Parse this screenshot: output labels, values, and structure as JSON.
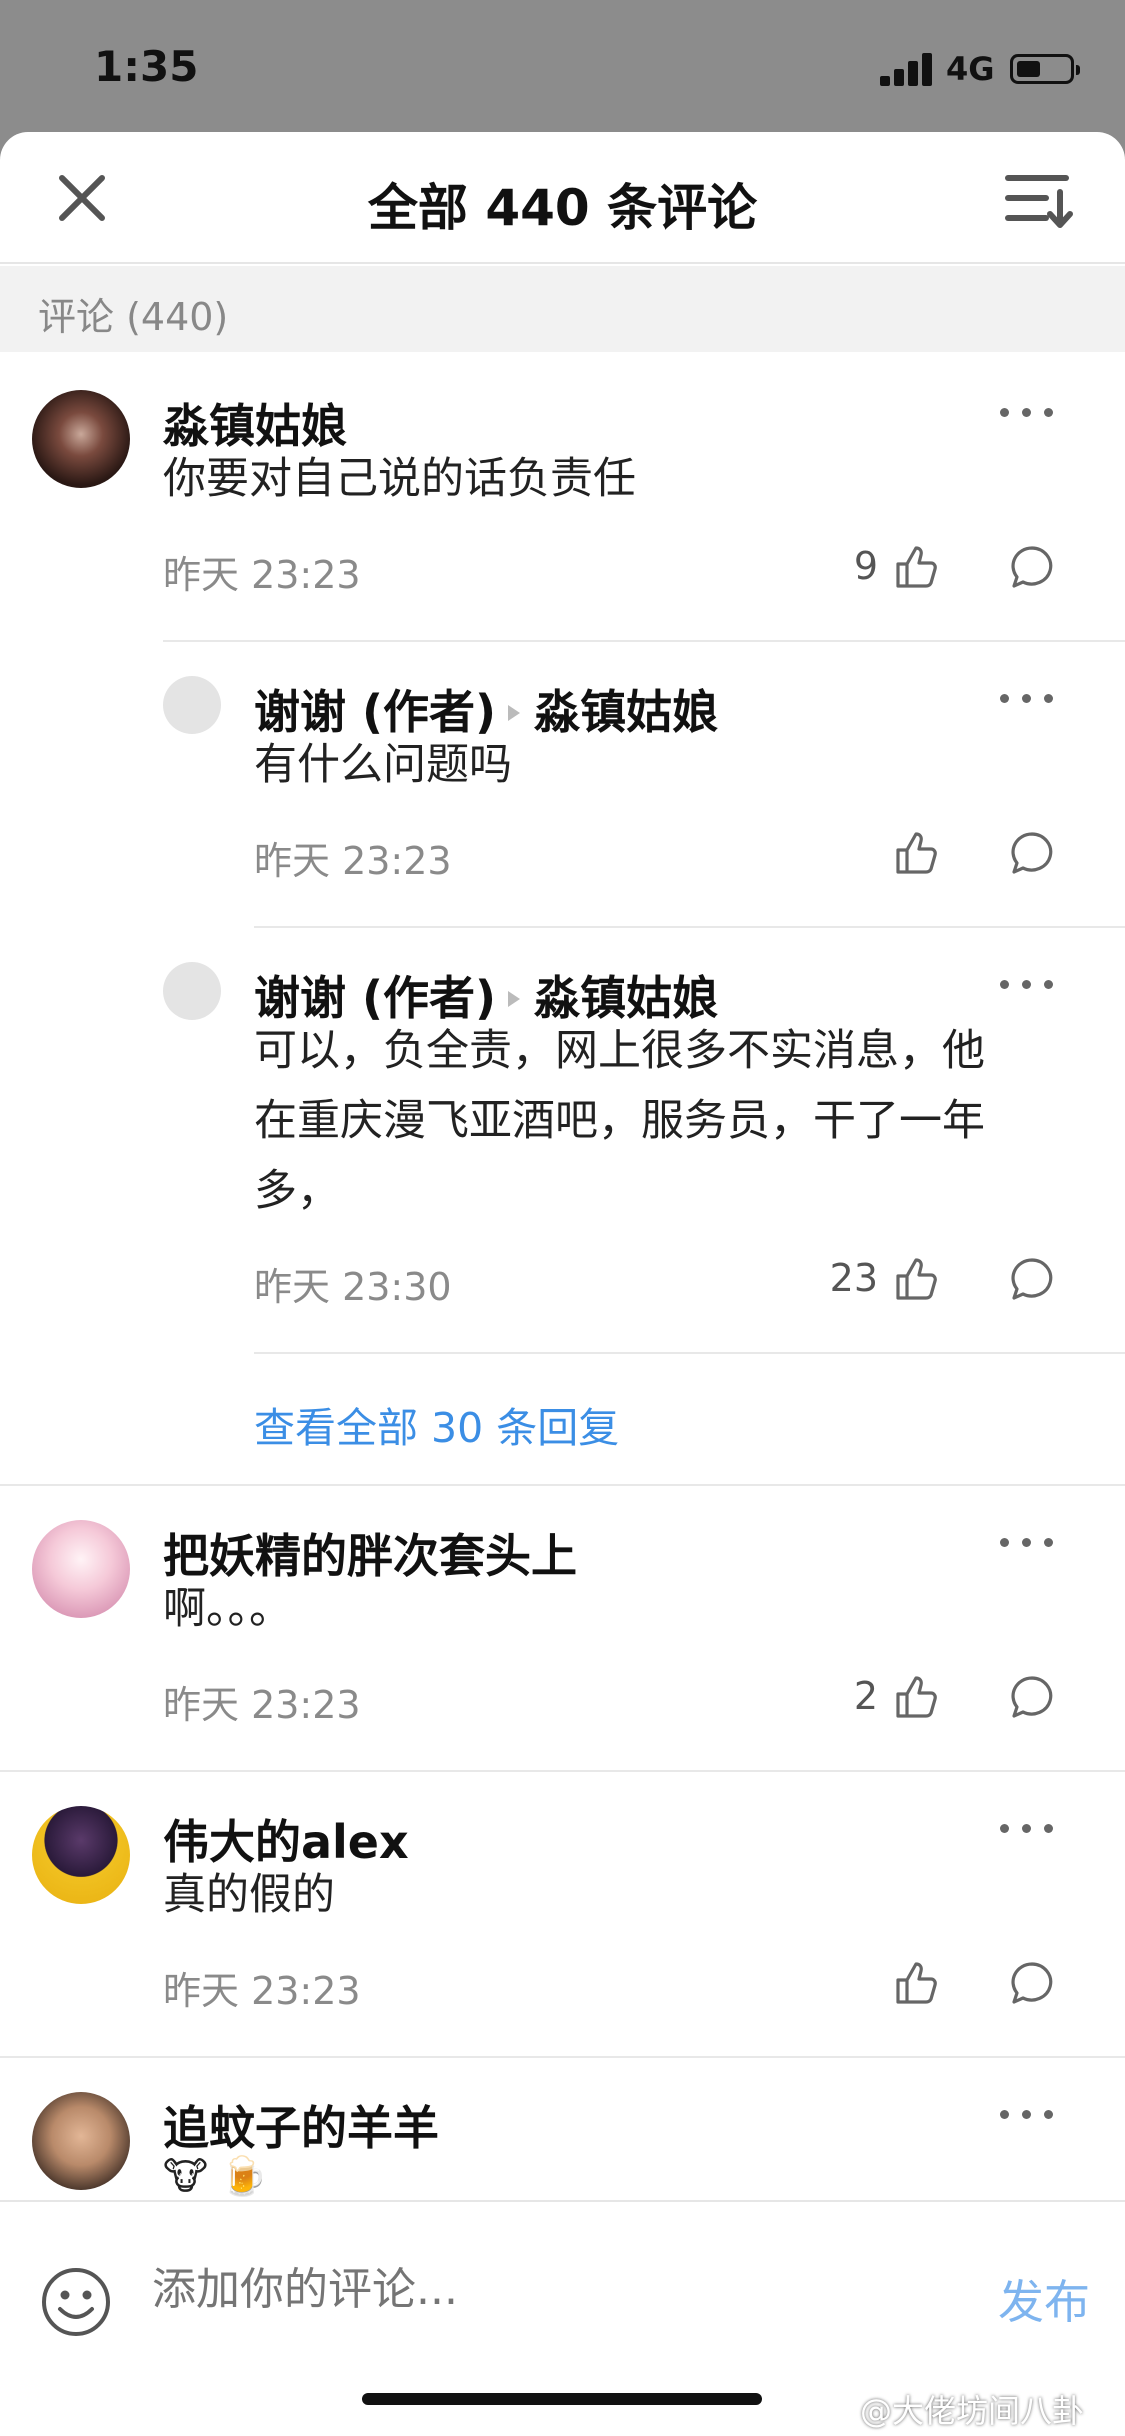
{
  "status": {
    "time": "1:35",
    "network": "4G",
    "battery_level": 0.45
  },
  "header": {
    "title": "全部 440 条评论"
  },
  "section": {
    "label": "评论 (440)"
  },
  "comments": [
    {
      "user": "淼镇姑娘",
      "text": "你要对自己说的话负责任",
      "time": "昨天 23:23",
      "likes": "9"
    },
    {
      "user": "把妖精的胖次套头上",
      "text": "啊。。。",
      "time": "昨天 23:23",
      "likes": "2"
    },
    {
      "user": "伟大的alex",
      "text": "真的假的",
      "time": "昨天 23:23",
      "likes": ""
    },
    {
      "user": "追蚊子的羊羊",
      "text": "🐮 🍺"
    }
  ],
  "replies": [
    {
      "user": "谢谢 (作者)",
      "to": "淼镇姑娘",
      "text": "有什么问题吗",
      "time": "昨天 23:23",
      "likes": ""
    },
    {
      "user": "谢谢 (作者)",
      "to": "淼镇姑娘",
      "text_lines": [
        "可以，负全责，网上很多不实消息，他",
        "在重庆漫飞亚酒吧，服务员，干了一年",
        "多，"
      ],
      "time": "昨天 23:30",
      "likes": "23"
    }
  ],
  "view_all": "查看全部 30 条回复",
  "input": {
    "placeholder": "添加你的评论..."
  },
  "publish_label": "发布",
  "watermark": "@大佬坊间八卦",
  "colors": {
    "link": "#3b8ee5",
    "publish": "#7eb4ef"
  }
}
